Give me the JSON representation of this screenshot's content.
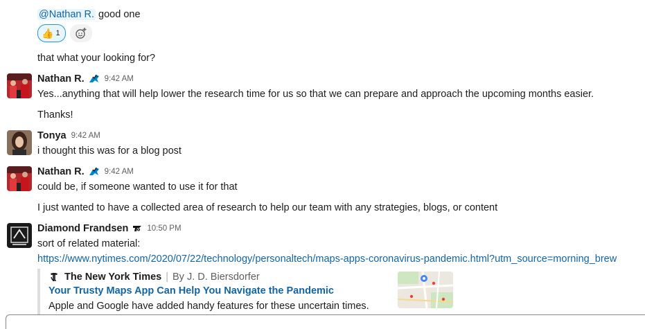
{
  "messages": {
    "top": {
      "mention": "@Nathan R.",
      "text": "good one",
      "reaction_emoji": "👍",
      "reaction_count": "1",
      "add_reaction_icon": "add-reaction-icon"
    },
    "followup": {
      "text": "that what your looking for?"
    },
    "nathan1": {
      "author": "Nathan R.",
      "time": "9:42 AM",
      "status_icon": "panther-icon",
      "lines": [
        "Yes...anything that will help lower the research time for us so that we can prepare and approach the upcoming months easier.",
        "Thanks!"
      ]
    },
    "tonya": {
      "author": "Tonya",
      "time": "9:42 AM",
      "lines": [
        "i thought this was for a blog post"
      ]
    },
    "nathan2": {
      "author": "Nathan R.",
      "time": "9:42 AM",
      "status_icon": "panther-icon",
      "lines": [
        "could be, if someone wanted to use it for that",
        "I just wanted to have a collected area of research to help our team with any strategies, blogs, or content"
      ]
    },
    "diamond": {
      "author": "Diamond Frandsen",
      "time": "10:50 PM",
      "status_icon": "flyers-icon",
      "text": "sort of related material:",
      "link": "https://www.nytimes.com/2020/07/22/technology/personaltech/maps-apps-coronavirus-pandemic.html?utm_source=morning_brew"
    }
  },
  "unfurl": {
    "source": "The New York Times",
    "byline": "By J. D. Biersdorfer",
    "title": "Your Trusty Maps App Can Help You Navigate the Pandemic",
    "description": "Apple and Google have added handy features for these uncertain times."
  },
  "colors": {
    "link": "#1264a3",
    "mention_bg": "#e8f5fa",
    "reaction_border": "#1d9bd1",
    "timestamp": "#616061"
  }
}
